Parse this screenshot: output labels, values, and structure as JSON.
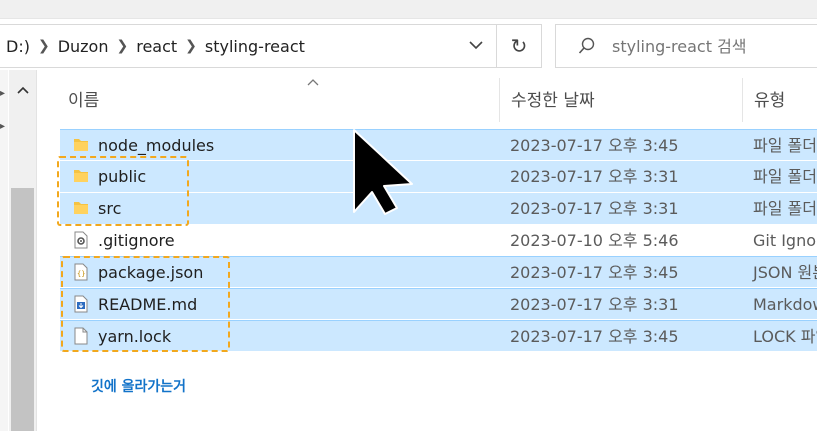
{
  "address": {
    "segments": [
      "D:)",
      "Duzon",
      "react",
      "styling-react"
    ]
  },
  "search": {
    "placeholder": "styling-react 검색"
  },
  "columns": {
    "name": "이름",
    "date": "수정한 날짜",
    "type": "유형"
  },
  "files": [
    {
      "name": "node_modules",
      "date": "2023-07-17 오후 3:45",
      "type": "파일 폴더",
      "icon": "folder-icon",
      "selected": true
    },
    {
      "name": "public",
      "date": "2023-07-17 오후 3:31",
      "type": "파일 폴더",
      "icon": "folder-icon",
      "selected": true
    },
    {
      "name": "src",
      "date": "2023-07-17 오후 3:31",
      "type": "파일 폴더",
      "icon": "folder-icon",
      "selected": true
    },
    {
      "name": ".gitignore",
      "date": "2023-07-10 오후 5:46",
      "type": "Git Ignore",
      "icon": "gear-file-icon",
      "selected": false
    },
    {
      "name": "package.json",
      "date": "2023-07-17 오후 3:45",
      "type": "JSON 원본",
      "icon": "json-file-icon",
      "selected": true
    },
    {
      "name": "README.md",
      "date": "2023-07-17 오후 3:31",
      "type": "Markdown",
      "icon": "markdown-file-icon",
      "selected": true
    },
    {
      "name": "yarn.lock",
      "date": "2023-07-17 오후 3:45",
      "type": "LOCK 파일",
      "icon": "file-icon",
      "selected": true
    }
  ],
  "annotation": {
    "caption": "깃에 올라가는거"
  },
  "colors": {
    "selection": "#cce8ff",
    "highlight_dash": "#f2a81d",
    "caption": "#1273c9"
  }
}
